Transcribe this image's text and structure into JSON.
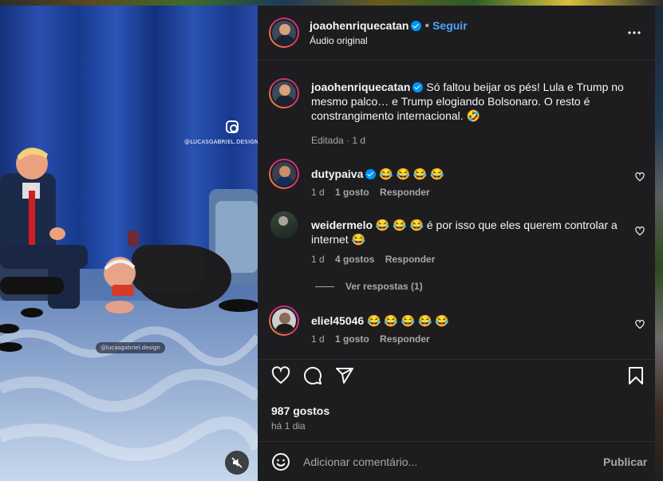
{
  "post": {
    "author": "joaohenriquecatan",
    "follow_label": "Seguir",
    "audio": "Áudio original",
    "separator": "•"
  },
  "media": {
    "watermark_handle": "@LUCASGABRIEL.DESIGN",
    "watermark_pill": "@lucasgabriel.design"
  },
  "caption": {
    "author": "joaohenriquecatan",
    "text": "Só faltou beijar os pés! Lula e Trump no mesmo palco… e Trump elogiando Bolsonaro. O resto é constrangimento internacional. 🤣",
    "meta": "Editada · 1 d"
  },
  "comments": [
    {
      "user": "dutypaiva",
      "text": "😂 😂 😂 😂",
      "time": "1 d",
      "likes": "1 gosto",
      "reply": "Responder",
      "verified": true
    },
    {
      "user": "weidermelo",
      "text": "😂 😂 😂  é por isso que eles querem controlar a internet 😂",
      "time": "1 d",
      "likes": "4 gostos",
      "reply": "Responder",
      "verified": false,
      "view_replies": "Ver respostas (1)"
    },
    {
      "user": "eliel45046",
      "text": "😂 😂 😂 😂 😂",
      "time": "1 d",
      "likes": "1 gosto",
      "reply": "Responder",
      "verified": false
    }
  ],
  "stats": {
    "likes": "987 gostos",
    "age": "há 1 dia"
  },
  "composer": {
    "placeholder": "Adicionar comentário...",
    "publish": "Publicar"
  },
  "colors": {
    "panel_bg": "#1d1d20",
    "accent": "#0095f6",
    "link": "#4ea5f8"
  },
  "icons": [
    "heart-icon",
    "comment-icon",
    "share-icon",
    "bookmark-icon",
    "more-icon",
    "emoji-icon",
    "mute-icon",
    "verified-icon",
    "instagram-icon"
  ]
}
